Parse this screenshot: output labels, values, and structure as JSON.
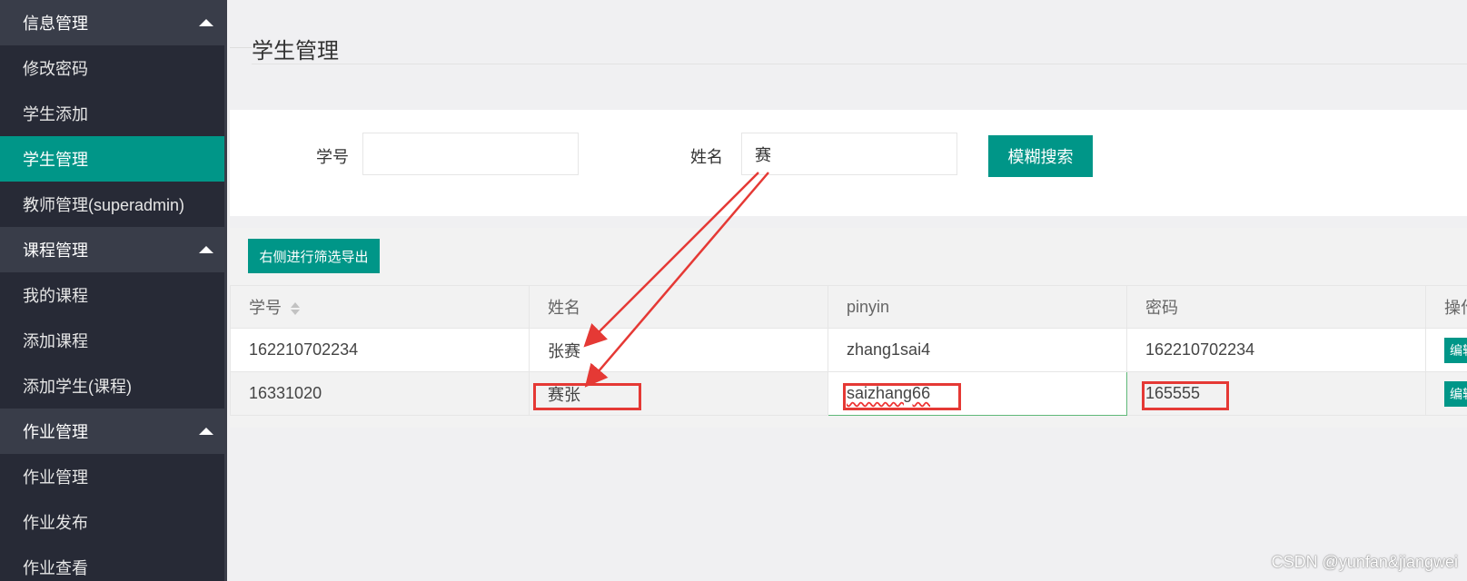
{
  "sidebar": {
    "groups": [
      {
        "title": "信息管理",
        "items": [
          "修改密码",
          "学生添加",
          "学生管理",
          "教师管理(superadmin)"
        ]
      },
      {
        "title": "课程管理",
        "items": [
          "我的课程",
          "添加课程",
          "添加学生(课程)"
        ]
      },
      {
        "title": "作业管理",
        "items": [
          "作业管理",
          "作业发布",
          "作业查看"
        ]
      }
    ],
    "active_item": "学生管理"
  },
  "page": {
    "title": "学生管理"
  },
  "search": {
    "id_label": "学号",
    "id_value": "",
    "name_label": "姓名",
    "name_value": "赛",
    "button": "模糊搜索"
  },
  "toolbar": {
    "export_button": "右侧进行筛选导出"
  },
  "table": {
    "headers": [
      "学号",
      "姓名",
      "pinyin",
      "密码",
      "操作"
    ],
    "rows": [
      {
        "id": "162210702234",
        "name": "张赛",
        "pinyin": "zhang1sai4",
        "password": "162210702234",
        "action": "编辑"
      },
      {
        "id": "16331020",
        "name": "赛张",
        "pinyin": "saizhang66",
        "password": "165555",
        "action": "编辑"
      }
    ]
  },
  "watermark": "CSDN @yunfan&jiangwei",
  "colors": {
    "accent": "#009688",
    "sidebar_bg": "#272a36",
    "annotation": "#e53935"
  }
}
